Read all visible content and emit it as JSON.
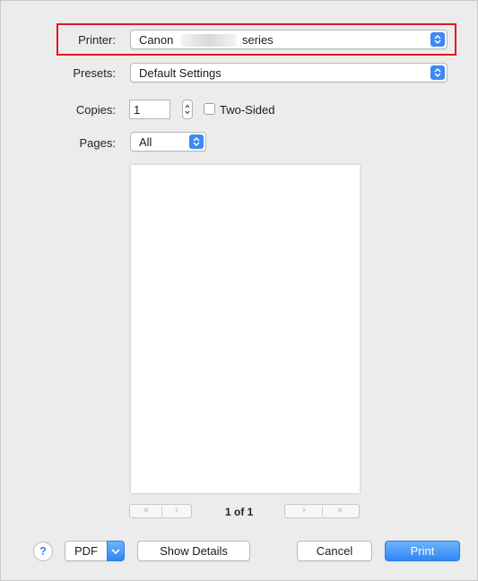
{
  "printer": {
    "label": "Printer:",
    "value_prefix": "Canon",
    "value_suffix": "series"
  },
  "presets": {
    "label": "Presets:",
    "value": "Default Settings"
  },
  "copies": {
    "label": "Copies:",
    "value": "1",
    "two_sided_label": "Two-Sided",
    "two_sided_checked": false
  },
  "pages": {
    "label": "Pages:",
    "value": "All"
  },
  "preview": {
    "page_indicator": "1 of 1"
  },
  "buttons": {
    "help": "?",
    "pdf": "PDF",
    "show_details": "Show Details",
    "cancel": "Cancel",
    "print": "Print"
  },
  "colors": {
    "accent": "#3b88f6",
    "highlight": "#e0181c"
  }
}
